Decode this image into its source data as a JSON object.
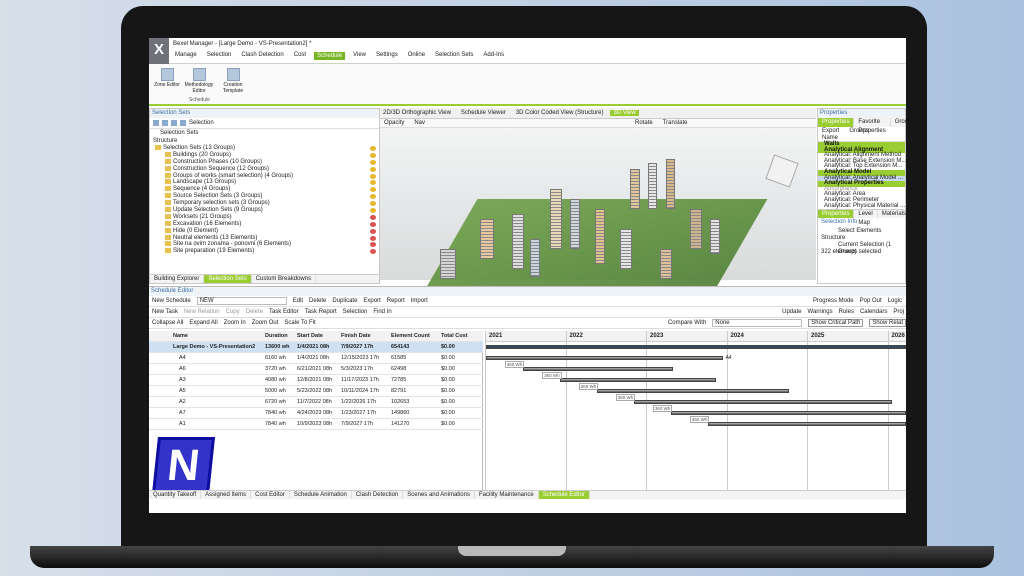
{
  "window": {
    "title": "Bexel Manager - [Large Demo - VS-Presentation2] *",
    "logo": "X"
  },
  "menu": [
    "Manage",
    "Selection",
    "Clash Detection",
    "Cost",
    "Schedule",
    "View",
    "Settings",
    "Online",
    "Selection Sets",
    "Add-Ins"
  ],
  "menu_active": "Schedule",
  "ribbon": {
    "buttons": [
      "Zone Editor",
      "Methodology Editor",
      "Creation Template"
    ],
    "group": "Schedule"
  },
  "selection_sets": {
    "title": "Selection Sets",
    "toolbar_label": "Selection",
    "sub_label": "Selection Sets",
    "structure": "Structure",
    "items": [
      "Selection Sets (13 Groups)",
      "Buildings (20 Groups)",
      "Construction Phases (10 Groups)",
      "Construction Sequence (12 Groups)",
      "Groups of works (smart selection) (4 Groups)",
      "Landscape (13 Groups)",
      "Sequence (4 Groups)",
      "Source Selection Sets (3 Groups)",
      "Temporary selection sets (3 Groups)",
      "Update Selection Sets (9 Groups)",
      "Worksets (21 Groups)",
      "Excavation (16 Elements)",
      "Hide (0 Element)",
      "Neutral elements (13 Elements)",
      "Site na ovim zonama - ponovni (6 Elements)",
      "Site preparation (19 Elements)"
    ],
    "tabs": [
      "Building Explorer",
      "Selection Sets",
      "Custom Breakdowns"
    ]
  },
  "view_tabs": [
    "2D/3D Orthographic View",
    "Schedule Viewer",
    "3D Color Coded View (Structure)",
    "3D View"
  ],
  "view_toolbar": [
    "Opacity",
    "Nav",
    "Rotate",
    "Translate"
  ],
  "properties": {
    "title": "Properties",
    "tabs": [
      "Properties",
      "Favorite Properties",
      "Groups"
    ],
    "export": "Export",
    "groups": "Groups",
    "name_col": "Name",
    "rows": [
      "Walls",
      "Analytical Alignment",
      "Analytical: Alignment Method",
      "Analytical: Base Extension M...",
      "Analytical: Top Extension M...",
      "Analytical Model",
      "Analytical: Analytical Model ...",
      "Analytical Properties",
      "Absorptance",
      "Analytical: Area",
      "Analytical: Perimeter",
      "Analytical: Physical Material ..."
    ],
    "bottom_tabs": [
      "Properties",
      "Level Map",
      "Materials"
    ],
    "selection_info": "Selection Info",
    "select_elements": "Select Elements",
    "structure": "Structure",
    "current_selection": "Current Selection (1 Group)",
    "selected_count": "322 elements selected"
  },
  "schedule": {
    "title": "Schedule Editor",
    "new_schedule": "New Schedule",
    "schedule_name": "NEW",
    "toolbar1": [
      "Edit",
      "Delete",
      "Duplicate",
      "Export",
      "Report",
      "Import"
    ],
    "progress_mode": "Progress Mode",
    "popout": "Pop Out",
    "logic": "Logic",
    "toolbar2": [
      "New Task",
      "New Relation",
      "Copy",
      "Delete",
      "Task Editor",
      "Task Report",
      "Selection",
      "Find In"
    ],
    "right_tools": [
      "Update",
      "Warnings",
      "Rules",
      "Calendars",
      "Proj"
    ],
    "toolbar3": [
      "Collapse All",
      "Expand All",
      "Zoom In",
      "Zoom Out",
      "Scale To Fit"
    ],
    "compare_with": "Compare With",
    "compare_value": "None",
    "show_critical": "Show Critical Path",
    "show_relations": "Show Relat",
    "columns": [
      "Name",
      "Duration",
      "Start Date",
      "Finish Date",
      "Element Count",
      "Total Cost"
    ],
    "rows": [
      {
        "name": "Large Demo - VS-Presentation2",
        "duration": "13600 wh",
        "start": "1/4/2021 08h",
        "finish": "7/9/2027 17h",
        "count": "654143",
        "cost": "$0.00"
      },
      {
        "name": "A4",
        "duration": "6160 wh",
        "start": "1/4/2021 08h",
        "finish": "12/15/2023 17h",
        "count": "61585",
        "cost": "$0.00"
      },
      {
        "name": "A6",
        "duration": "3720 wh",
        "start": "6/21/2021 08h",
        "finish": "5/3/2023 17h",
        "count": "62498",
        "cost": "$0.00"
      },
      {
        "name": "A3",
        "duration": "4080 wh",
        "start": "12/8/2021 08h",
        "finish": "11/17/2023 17h",
        "count": "72785",
        "cost": "$0.00"
      },
      {
        "name": "A5",
        "duration": "5000 wh",
        "start": "5/23/2022 08h",
        "finish": "10/11/2024 17h",
        "count": "82791",
        "cost": "$0.00"
      },
      {
        "name": "A2",
        "duration": "6720 wh",
        "start": "11/7/2022 08h",
        "finish": "1/22/2026 17h",
        "count": "102653",
        "cost": "$0.00"
      },
      {
        "name": "A7",
        "duration": "7840 wh",
        "start": "4/24/2023 08h",
        "finish": "1/23/2027 17h",
        "count": "149860",
        "cost": "$0.00"
      },
      {
        "name": "A1",
        "duration": "7840 wh",
        "start": "10/9/2023 08h",
        "finish": "7/9/2027 17h",
        "count": "141270",
        "cost": "$0.00"
      }
    ],
    "years": [
      "2021",
      "2022",
      "2023",
      "2024",
      "2025",
      "2026"
    ],
    "bar_labels": [
      "A4",
      "360 Wh",
      "360 Wh",
      "360 Wh",
      "360 Wh",
      "360 Wh",
      "360 Wh"
    ]
  },
  "bottom_tabs": [
    "Quantity Takeoff",
    "Assigned Items",
    "Cost Editor",
    "Schedule Animation",
    "Clash Detection",
    "Scenes and Animations",
    "Facility Maintenance",
    "Schedule Editor"
  ],
  "overlay_letter": "N"
}
